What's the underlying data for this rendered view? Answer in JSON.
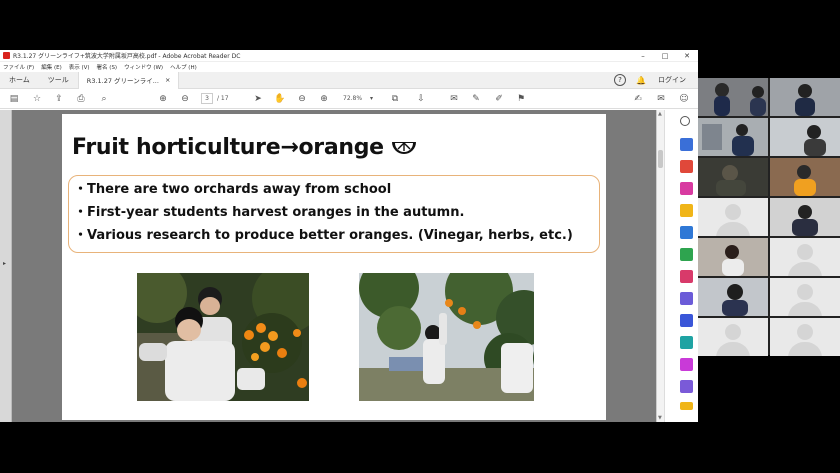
{
  "window": {
    "title": "R3.1.27 グリーンライフ+筑波大学附属坂戸高校.pdf - Adobe Acrobat Reader DC",
    "minimize": "–",
    "maximize": "□",
    "close": "✕"
  },
  "menu": [
    "ファイル (F)",
    "編集 (E)",
    "表示 (V)",
    "署名 (S)",
    "ウィンドウ (W)",
    "ヘルプ (H)"
  ],
  "tabs": {
    "home": "ホーム",
    "tools": "ツール",
    "document": "R3.1.27 グリーンライ...",
    "document_close": "×",
    "help": "?",
    "login": "ログイン"
  },
  "toolbar": {
    "current_page": "3",
    "total_pages": "/ 17",
    "zoom": "72.8%",
    "zoom_caret": "▾"
  },
  "slide": {
    "title": "Fruit horticulture→orange",
    "bullets": [
      "・There are two orchards away from school",
      "・First-year students harvest oranges in the autumn.",
      "・Various research to produce better oranges. (Vinegar, herbs, etc.)"
    ]
  },
  "colors": {
    "acrobat_red": "#d9231e",
    "bullet_border": "#e8b37a"
  }
}
